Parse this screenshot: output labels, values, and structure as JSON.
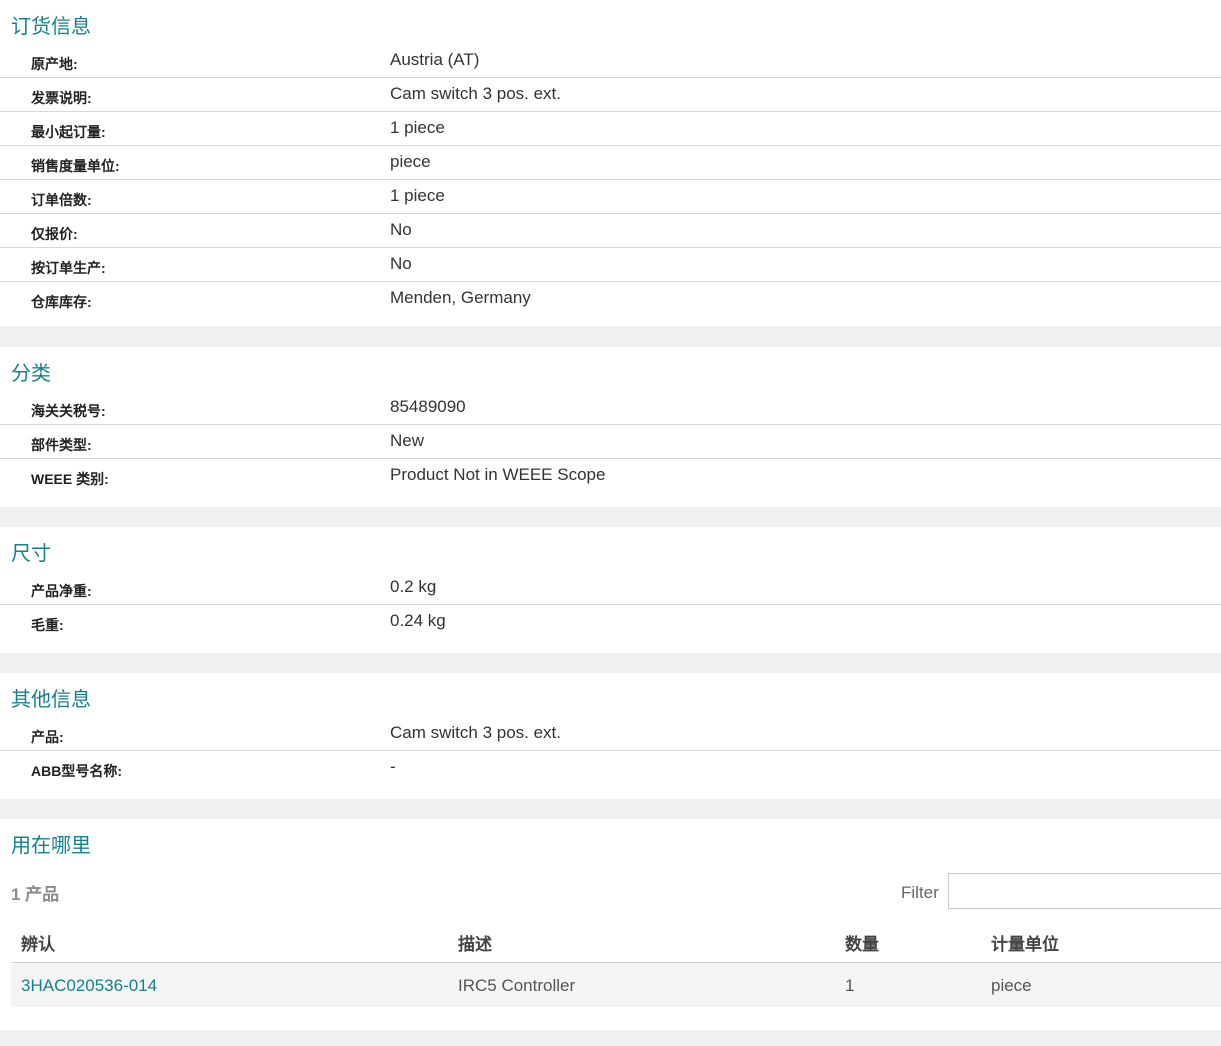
{
  "ordering": {
    "title": "订货信息",
    "rows": [
      {
        "label": "原产地:",
        "value": "Austria (AT)"
      },
      {
        "label": "发票说明:",
        "value": "Cam switch 3 pos. ext."
      },
      {
        "label": "最小起订量:",
        "value": "1 piece"
      },
      {
        "label": "销售度量单位:",
        "value": "piece"
      },
      {
        "label": "订单倍数:",
        "value": "1 piece"
      },
      {
        "label": "仅报价:",
        "value": "No"
      },
      {
        "label": "按订单生产:",
        "value": "No"
      },
      {
        "label": "仓库库存:",
        "value": "Menden, Germany"
      }
    ]
  },
  "classification": {
    "title": "分类",
    "rows": [
      {
        "label": "海关关税号:",
        "value": "85489090"
      },
      {
        "label": "部件类型:",
        "value": "New"
      },
      {
        "label": "WEEE 类别:",
        "value": "Product Not in WEEE Scope"
      }
    ]
  },
  "dimensions": {
    "title": "尺寸",
    "rows": [
      {
        "label": "产品净重:",
        "value": "0.2 kg"
      },
      {
        "label": "毛重:",
        "value": "0.24 kg"
      }
    ]
  },
  "other": {
    "title": "其他信息",
    "rows": [
      {
        "label": "产品:",
        "value": "Cam switch 3 pos. ext."
      },
      {
        "label": "ABB型号名称:",
        "value": "-"
      }
    ]
  },
  "where_used": {
    "title": "用在哪里",
    "count_label": "1 产品",
    "filter_label": "Filter",
    "filter_value": "",
    "columns": [
      "辨认",
      "描述",
      "数量",
      "计量单位"
    ],
    "rows": [
      {
        "id": "3HAC020536-014",
        "description": "IRC5 Controller",
        "quantity": "1",
        "unit": "piece"
      }
    ]
  }
}
